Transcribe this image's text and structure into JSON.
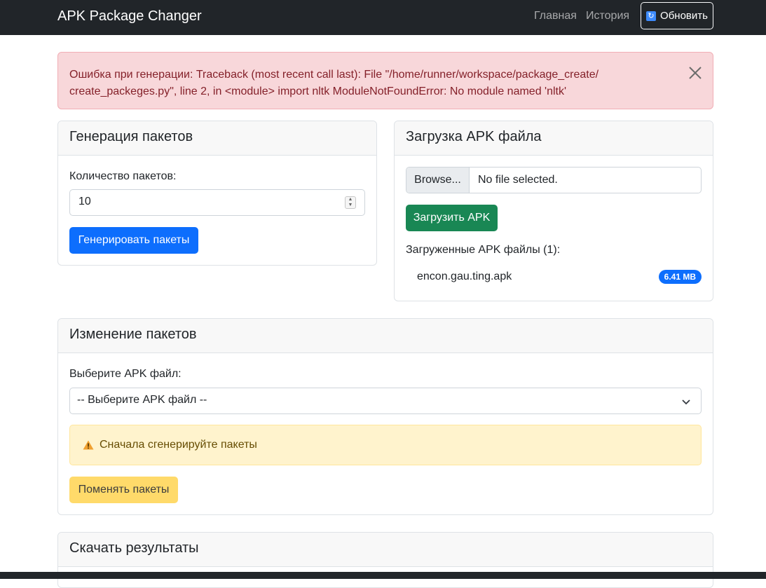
{
  "navbar": {
    "brand": "APK Package Changer",
    "links": [
      "Главная",
      "История"
    ],
    "refresh_label": "Обновить"
  },
  "error_alert": {
    "text": "Ошибка при генерации: Traceback (most recent call last): File \"/home/runner/workspace/package_create/ create_packeges.py\", line 2, in <module> import nltk ModuleNotFoundError: No module named 'nltk'"
  },
  "generation": {
    "title": "Генерация пакетов",
    "count_label": "Количество пакетов:",
    "count_value": "10",
    "button": "Генерировать пакеты"
  },
  "upload": {
    "title": "Загрузка APK файла",
    "browse_label": "Browse...",
    "file_status": "No file selected.",
    "button": "Загрузить APK",
    "uploaded_label": "Загруженные APK файлы (1):",
    "files": [
      {
        "name": "encon.gau.ting.apk",
        "size": "6.41 MB"
      }
    ]
  },
  "change": {
    "title": "Изменение пакетов",
    "select_label": "Выберите APK файл:",
    "select_value": "-- Выберите APK файл --",
    "warning": "Сначала сгенерируйте пакеты",
    "button": "Поменять пакеты"
  },
  "download": {
    "title": "Скачать результаты"
  },
  "colors": {
    "navbar": "#212529",
    "primary": "#0d6efd",
    "success": "#198754",
    "warning": "#ffda6a",
    "danger_bg": "#f8d7da"
  },
  "icons": [
    "refresh-icon",
    "close-icon",
    "chevron-down-icon",
    "warning-icon",
    "spinner-arrows-icon"
  ]
}
